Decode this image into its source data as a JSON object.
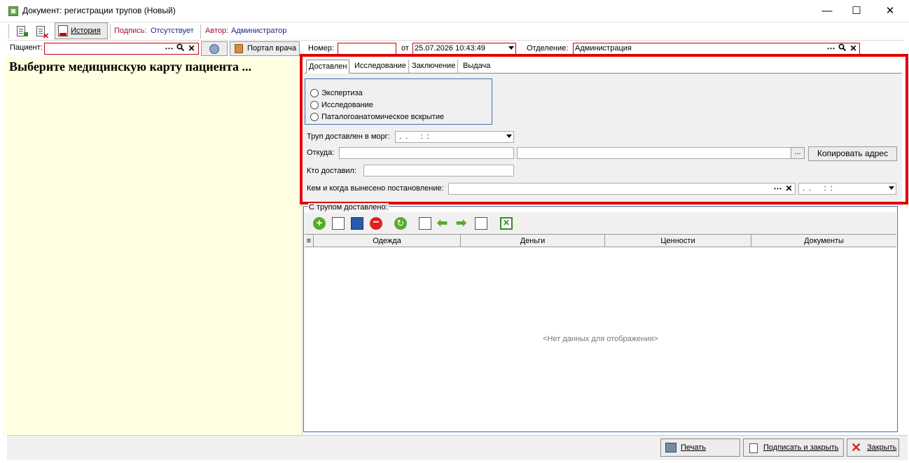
{
  "window": {
    "title": "Документ: регистрации трупов (Новый)",
    "min": "—",
    "max": "☐",
    "close": "✕"
  },
  "toolbar": {
    "history_label": "История",
    "sign_label": "Подпись:",
    "sign_value": "Отсутствует",
    "author_label": "Автор:",
    "author_value": "Администратор"
  },
  "header": {
    "patient_label": "Пациент:",
    "patient_value": "",
    "doctor_portal": "Портал врача",
    "number_label": "Номер:",
    "number_value": "",
    "from_label": "от",
    "date_value": "25.07.2026 10:43:49",
    "department_label": "Отделение:",
    "department_value": "Администрация"
  },
  "left": {
    "prompt": "Выберите медицинскую карту пациента ..."
  },
  "tabs": [
    {
      "label": "Доставлен",
      "active": true
    },
    {
      "label": "Исследование",
      "active": false
    },
    {
      "label": "Заключение",
      "active": false
    },
    {
      "label": "Выдача",
      "active": false
    }
  ],
  "delivered": {
    "radios": [
      "Экспертиза",
      "Исследование",
      "Паталогоанатомическое вскрытие"
    ],
    "delivered_label": "Труп доставлен в морг:",
    "delivered_date": " .  .      :  :",
    "from_label": "Откуда:",
    "from_value": "",
    "from_address": "",
    "ellipsis": "...",
    "copy_address": "Копировать адрес",
    "who_label": "Кто доставил:",
    "who_value": "",
    "resolution_label": "Кем и когда вынесено постановление:",
    "resolution_value": "",
    "resolution_date": " .  .      :  :"
  },
  "goods": {
    "legend": "С трупом доставлено:",
    "columns": [
      "Одежда",
      "Деньги",
      "Ценности",
      "Документы"
    ],
    "empty": "<Нет данных для отображения>"
  },
  "footer": {
    "print": "Печать",
    "sign_close": "Подписать и закрыть",
    "close": "Закрыть"
  }
}
